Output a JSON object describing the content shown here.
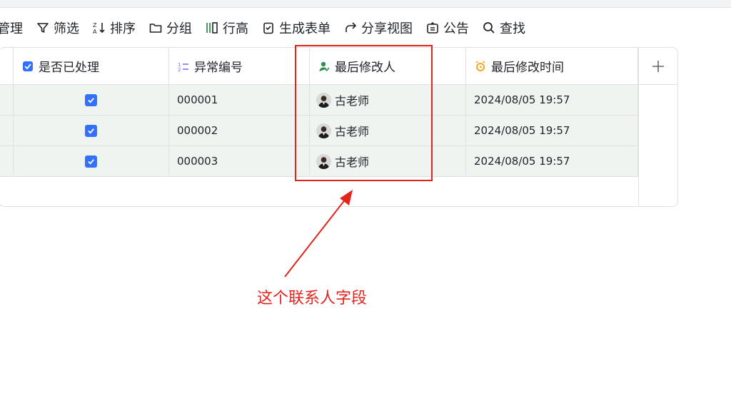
{
  "toolbar": {
    "items": [
      {
        "label": "管理",
        "icon": "manage-icon"
      },
      {
        "label": "筛选",
        "icon": "filter-icon"
      },
      {
        "label": "排序",
        "icon": "sort-icon"
      },
      {
        "label": "分组",
        "icon": "folder-icon"
      },
      {
        "label": "行高",
        "icon": "row-height-icon"
      },
      {
        "label": "生成表单",
        "icon": "form-icon"
      },
      {
        "label": "分享视图",
        "icon": "share-icon"
      },
      {
        "label": "公告",
        "icon": "announcement-icon"
      },
      {
        "label": "查找",
        "icon": "search-icon"
      }
    ]
  },
  "grid": {
    "columns": [
      {
        "label": "是否已处理",
        "icon": "checkbox-field-icon"
      },
      {
        "label": "异常编号",
        "icon": "auto-number-icon"
      },
      {
        "label": "最后修改人",
        "icon": "person-field-icon"
      },
      {
        "label": "最后修改时间",
        "icon": "alarm-clock-icon"
      }
    ],
    "rows": [
      {
        "processed": true,
        "number": "000001",
        "modifier": "古老师",
        "modified_time": "2024/08/05 19:57"
      },
      {
        "processed": true,
        "number": "000002",
        "modifier": "古老师",
        "modified_time": "2024/08/05 19:57"
      },
      {
        "processed": true,
        "number": "000003",
        "modifier": "古老师",
        "modified_time": "2024/08/05 19:57"
      }
    ]
  },
  "annotation": {
    "text": "这个联系人字段",
    "color": "#e2241c"
  },
  "colors": {
    "accent": "#3370ff",
    "row_bg": "#eef5f1",
    "border": "#dee0e3"
  }
}
